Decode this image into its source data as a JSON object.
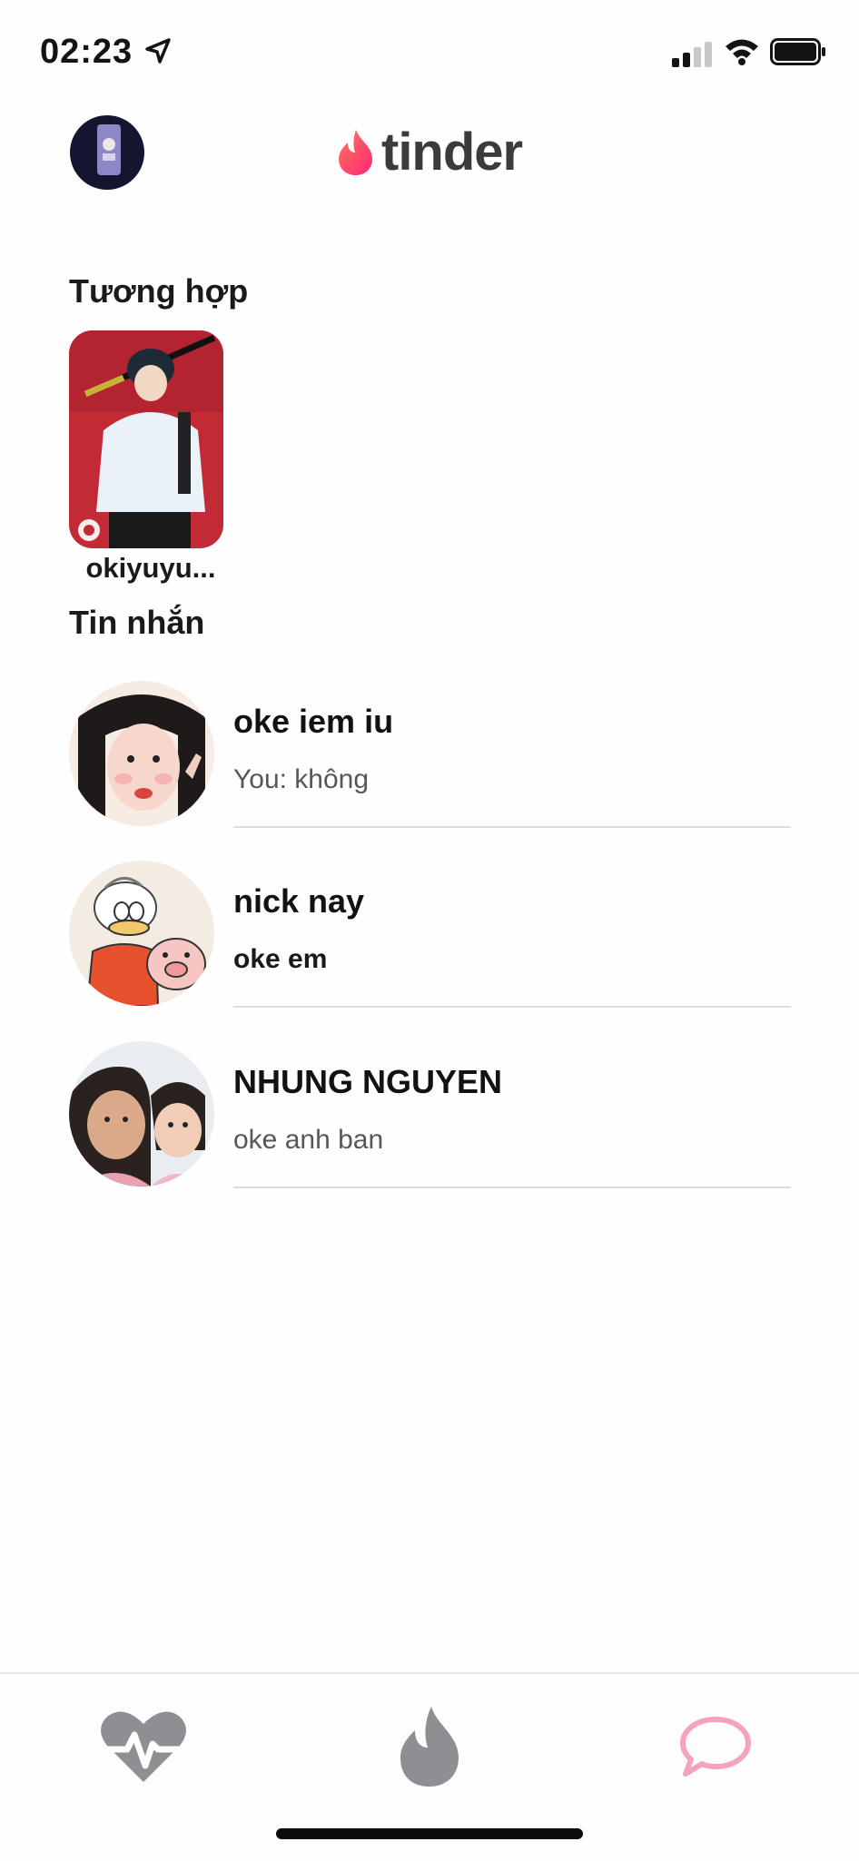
{
  "status_bar": {
    "time": "02:23"
  },
  "header": {
    "logo_text": "tinder"
  },
  "matches": {
    "title": "Tương hợp",
    "items": [
      {
        "name": "okiyuyu..."
      }
    ]
  },
  "messages": {
    "title": "Tin nhắn",
    "items": [
      {
        "name": "oke iem iu",
        "preview": "You: không",
        "unread": false
      },
      {
        "name": "nick nay",
        "preview": "oke em",
        "unread": true
      },
      {
        "name": "NHUNG NGUYEN",
        "preview": "oke anh ban",
        "unread": false
      }
    ]
  },
  "tab_bar": {
    "tabs": [
      {
        "icon": "heart-pulse-icon",
        "active": false
      },
      {
        "icon": "flame-icon",
        "active": false
      },
      {
        "icon": "chat-bubble-icon",
        "active": true
      }
    ]
  },
  "colors": {
    "brand_gradient_start": "#fd267a",
    "brand_gradient_end": "#ff7854",
    "active_tab": "#f5a3b8",
    "inactive_tab": "#8e8e93"
  }
}
